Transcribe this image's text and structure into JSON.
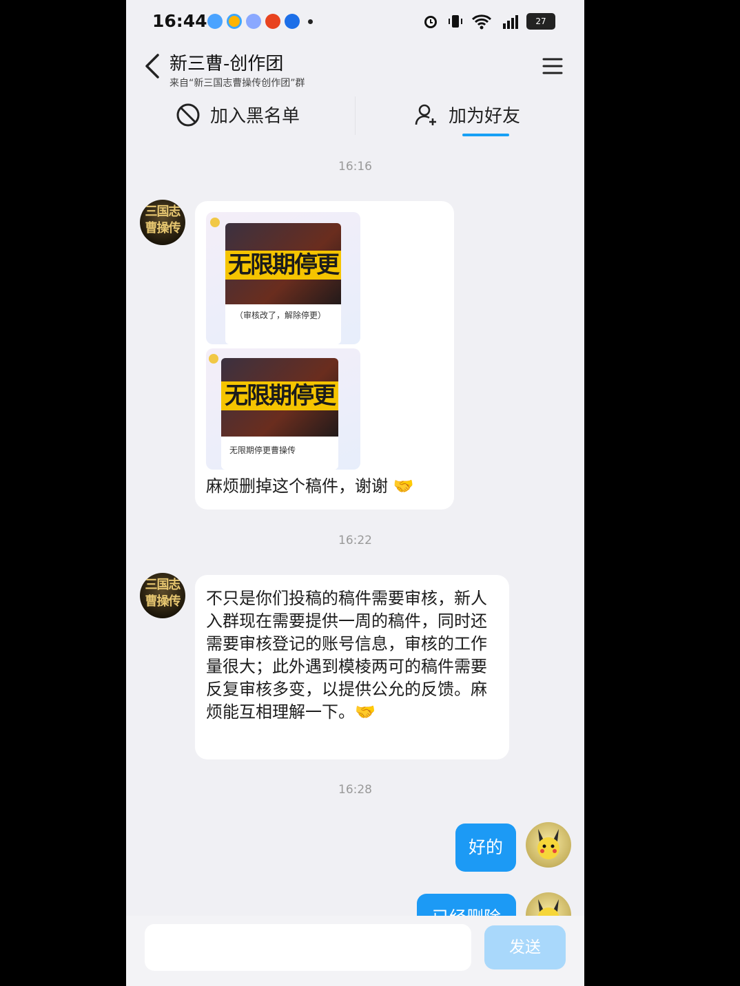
{
  "status_bar": {
    "time": "16:44",
    "battery": "27"
  },
  "header": {
    "title": "新三曹-创作团",
    "subtitle": "来自“新三国志曹操传创作团”群"
  },
  "actions": {
    "block_label": "加入黑名单",
    "add_friend_label": "加为好友"
  },
  "messages": [
    {
      "timestamp": "16:16"
    },
    {
      "timestamp": "16:22"
    },
    {
      "timestamp": "16:28"
    }
  ],
  "msg1": {
    "avatar_text": "三国志曹操传",
    "card1": {
      "thumb_title": "无限期停更",
      "caption": "（审核改了，解除停更）"
    },
    "card2": {
      "thumb_title": "无限期停更",
      "caption": "无限期停更曹操传"
    },
    "text": "麻烦删掉这个稿件，谢谢 🤝"
  },
  "msg2": {
    "avatar_text": "三国志曹操传",
    "text": "不只是你们投稿的稿件需要审核，新人入群现在需要提供一周的稿件，同时还需要审核登记的账号信息，审核的工作量很大；此外遇到模棱两可的稿件需要反复审核多变，以提供公允的反馈。麻烦能互相理解一下。🤝"
  },
  "msg3": {
    "text": "好的"
  },
  "msg4": {
    "text": "已经删除"
  },
  "input": {
    "placeholder": "",
    "send_label": "发送"
  },
  "colors": {
    "accent": "#1c9af5",
    "send_disabled": "#a9d8fb",
    "background": "#f0f0f4"
  }
}
